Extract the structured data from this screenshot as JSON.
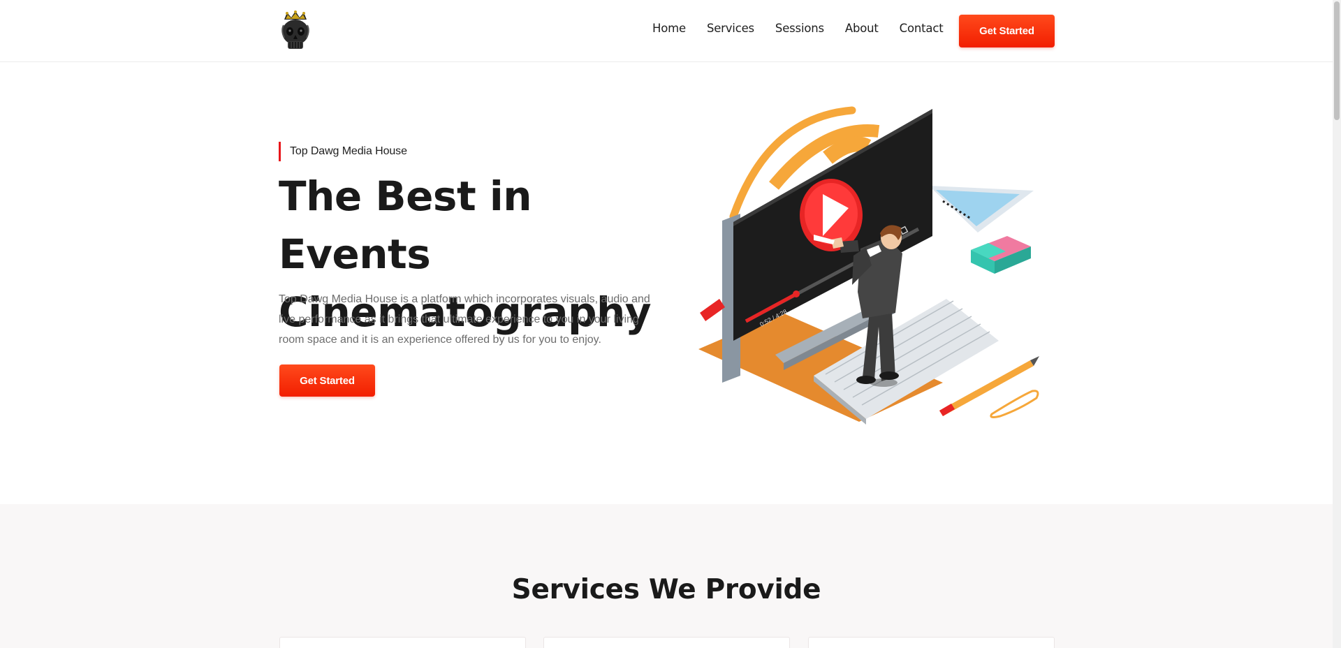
{
  "header": {
    "logo_name": "skull-crown-logo",
    "nav": [
      {
        "label": "Home"
      },
      {
        "label": "Services"
      },
      {
        "label": "Sessions"
      },
      {
        "label": "About"
      },
      {
        "label": "Contact"
      }
    ],
    "cta_label": "Get Started"
  },
  "hero": {
    "eyebrow": "Top Dawg Media House",
    "title": "The Best in Events Cinematography",
    "description": "Top Dawg Media House is a platform which incorporates visuals, audio and live performance as it brings that ultimate experience to you in your living room space and it is an experience offered by us for you to enjoy.",
    "cta_label": "Get Started",
    "illustration_name": "man-at-monitor-video-illustration",
    "player_time": "0:52 / 4:28"
  },
  "services": {
    "title": "Services We Provide",
    "cards": [
      {},
      {},
      {}
    ]
  },
  "colors": {
    "accent": "#f21e00",
    "accent_light": "#ff4a1c",
    "eyebrow_bar": "#e8161b",
    "heading": "#1a1a1a",
    "body_text": "#6d6d6d",
    "section_bg": "#f9f7f7",
    "illustration_orange": "#f6a73a"
  }
}
